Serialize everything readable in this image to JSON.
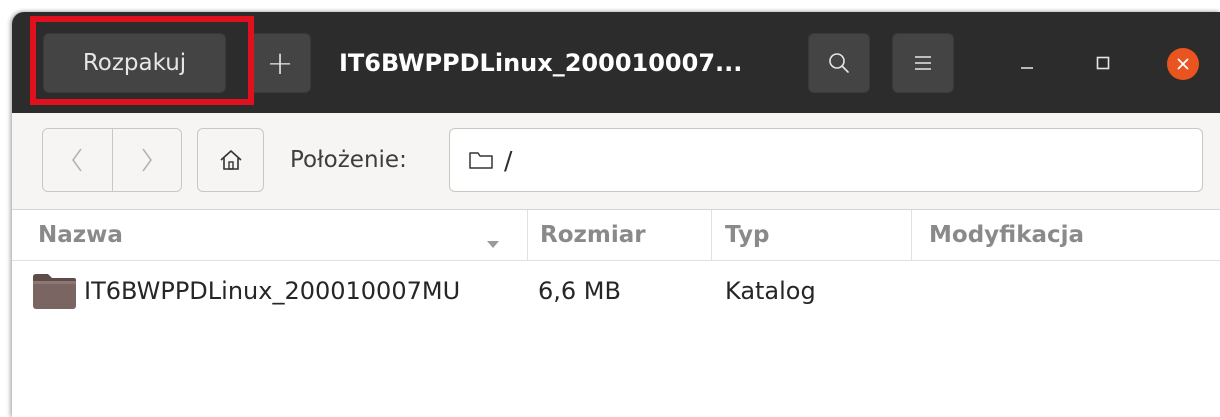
{
  "headerbar": {
    "extract_label": "Rozpakuj",
    "add_label": "+",
    "title": "IT6BWPPDLinux_200010007..."
  },
  "toolbar": {
    "location_label": "Położenie:",
    "location_value": "/"
  },
  "columns": {
    "name": "Nazwa",
    "size": "Rozmiar",
    "type": "Typ",
    "modified": "Modyfikacja"
  },
  "rows": [
    {
      "name": "IT6BWPPDLinux_200010007MU",
      "size": "6,6 MB",
      "type": "Katalog",
      "modified": ""
    }
  ],
  "icons": {
    "search": "search-icon",
    "menu": "hamburger-menu-icon",
    "minimize": "minimize-icon",
    "maximize": "maximize-icon",
    "close": "close-icon",
    "back": "chevron-left-icon",
    "forward": "chevron-right-icon",
    "home": "home-icon",
    "folder": "folder-icon",
    "sort": "sort-down-icon"
  },
  "colors": {
    "headerbar_bg": "#2c2c2c",
    "close_button": "#e95420",
    "highlight_box": "#e0101e",
    "folder_icon": "#7a6562"
  }
}
